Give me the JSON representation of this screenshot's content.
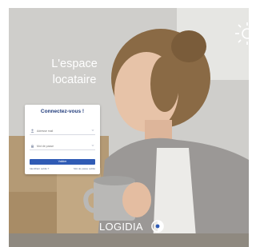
{
  "hero": {
    "line1": "L'espace",
    "line2": "locataire"
  },
  "login": {
    "title": "Connectez-vous !",
    "username_placeholder": "Adresse mail",
    "password_placeholder": "Mot de passe",
    "submit_label": "Valider",
    "forgot_link": "Identifiant oublié ?",
    "forgot_password_link": "Mot de passe oublié"
  },
  "brand": {
    "name": "LOGIDIA"
  },
  "colors": {
    "accent": "#2f5bb5",
    "title": "#1f3a7a",
    "text_light": "#ffffff"
  },
  "icons": [
    "user-icon",
    "lock-icon",
    "chevron-down-icon",
    "sun-icon",
    "brand-logo-mark"
  ]
}
